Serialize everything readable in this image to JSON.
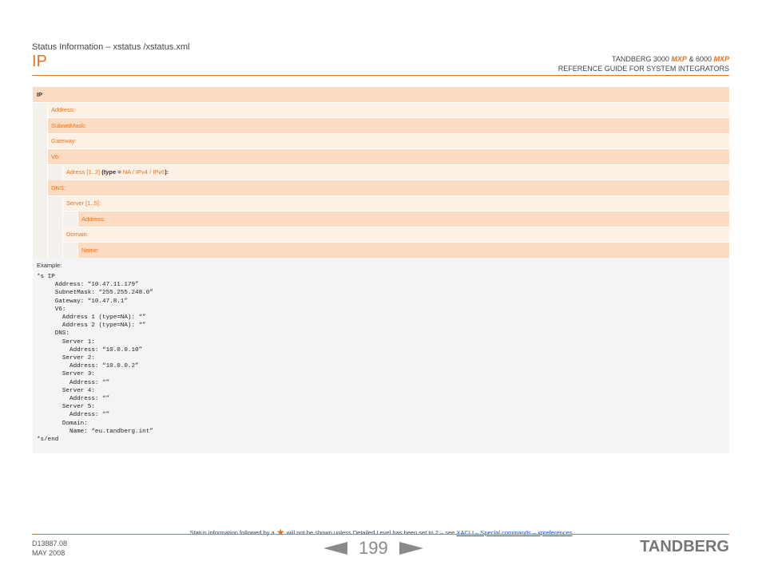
{
  "header": {
    "section": "Status Information – xstatus /xstatus.xml",
    "title": "IP",
    "product_prefix": "TANDBERG 3000",
    "product_mxp1": "MXP",
    "product_mid": "& 6000",
    "product_mxp2": "MXP",
    "guide": "REFERENCE GUIDE FOR SYSTEM INTEGRATORS"
  },
  "table": {
    "rows": [
      {
        "label": "IP"
      },
      {
        "label": "Address:"
      },
      {
        "label": "SubnetMask:"
      },
      {
        "label": "Gateway:"
      },
      {
        "label": "V6:"
      },
      {
        "label_a": "Adress [1..2]",
        "label_b": "(type =",
        "label_c": "NA / IPv4 / IPv6",
        "label_d": "):"
      },
      {
        "label": "DNS:"
      },
      {
        "label": "Server [1..5]:"
      },
      {
        "label": "Address:"
      },
      {
        "label": "Domain:"
      },
      {
        "label": "Name:"
      }
    ]
  },
  "example": {
    "label": "Example:",
    "code": "*s IP\n     Address: “10.47.11.179”\n     SubnetMask: “255.255.248.0”\n     Gateway: “10.47.8.1”\n     V6:\n       Address 1 (type=NA): “”\n       Address 2 (type=NA): “”\n     DNS:\n       Server 1:\n         Address: “10.0.0.10”\n       Server 2:\n         Address: “10.0.0.2”\n       Server 3:\n         Address: “”\n       Server 4:\n         Address: “”\n       Server 5:\n         Address: “”\n       Domain:\n         Name: “eu.tandberg.int”\n*s/end"
  },
  "footer": {
    "note_pre": "Status information followed by a",
    "note_mid": "will not be shown unless Detailed Level has been set to 2 – see",
    "note_link": "XACLI – Special commands – xpreferences",
    "doc_number": "D13887.08",
    "date": "MAY 2008",
    "page": "199",
    "logo": "TANDBERG"
  },
  "colors": {
    "accent": "#e8731e",
    "row_dark": "#fbdcc2",
    "row_light": "#fdf0e5",
    "link": "#1a55c4"
  },
  "icons": [
    "star-icon",
    "prev-arrow-icon",
    "next-arrow-icon"
  ]
}
